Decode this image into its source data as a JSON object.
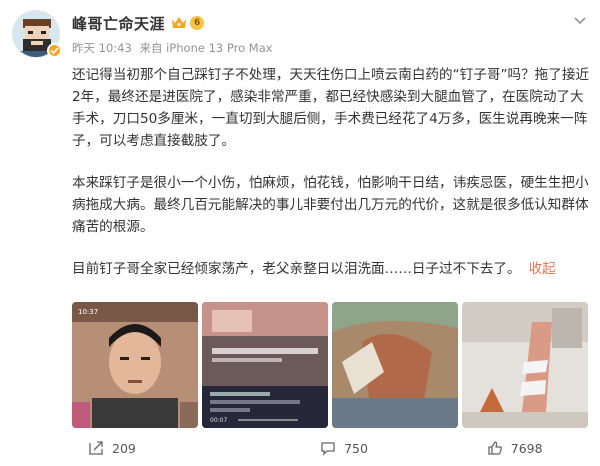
{
  "post": {
    "author": {
      "name": "峰哥亡命天涯",
      "level_badge": "6"
    },
    "meta": {
      "time": "昨天 10:43",
      "source": "来自 iPhone 13 Pro Max"
    },
    "paragraphs": [
      "还记得当初那个自己踩钉子不处理，天天往伤口上喷云南白药的“钉子哥”吗？拖了接近2年，最终还是进医院了，感染非常严重，都已经快感染到大腿血管了，在医院动了大手术，刀口50多厘米，一直切到大腿后侧，手术费已经花了4万多，医生说再晚来一阵子，可以考虑直接截肢了。",
      "本来踩钉子是很小一个小伤，怕麻烦，怕花钱，怕影响干日结，讳疾忌医，硬生生把小病拖成大病。最终几百元能解决的事儿非要付出几万元的代价，这就是很多低认知群体痛苦的根源。",
      "目前钉子哥全家已经倾家荡产，老父亲整日以泪洗面……日子过不下去了。"
    ],
    "collapse_label": "收起",
    "images": [
      {
        "name": "photo-man-selfie",
        "time_text": "10:37"
      },
      {
        "name": "photo-video-screenshot",
        "time_text": "00:07"
      },
      {
        "name": "photo-bandaged-arm"
      },
      {
        "name": "photo-hospital-leg"
      }
    ],
    "actions": {
      "share_count": "209",
      "comment_count": "750",
      "like_count": "7698"
    }
  },
  "colors": {
    "link": "#eb7350",
    "meta": "#939393",
    "text": "#333333"
  }
}
